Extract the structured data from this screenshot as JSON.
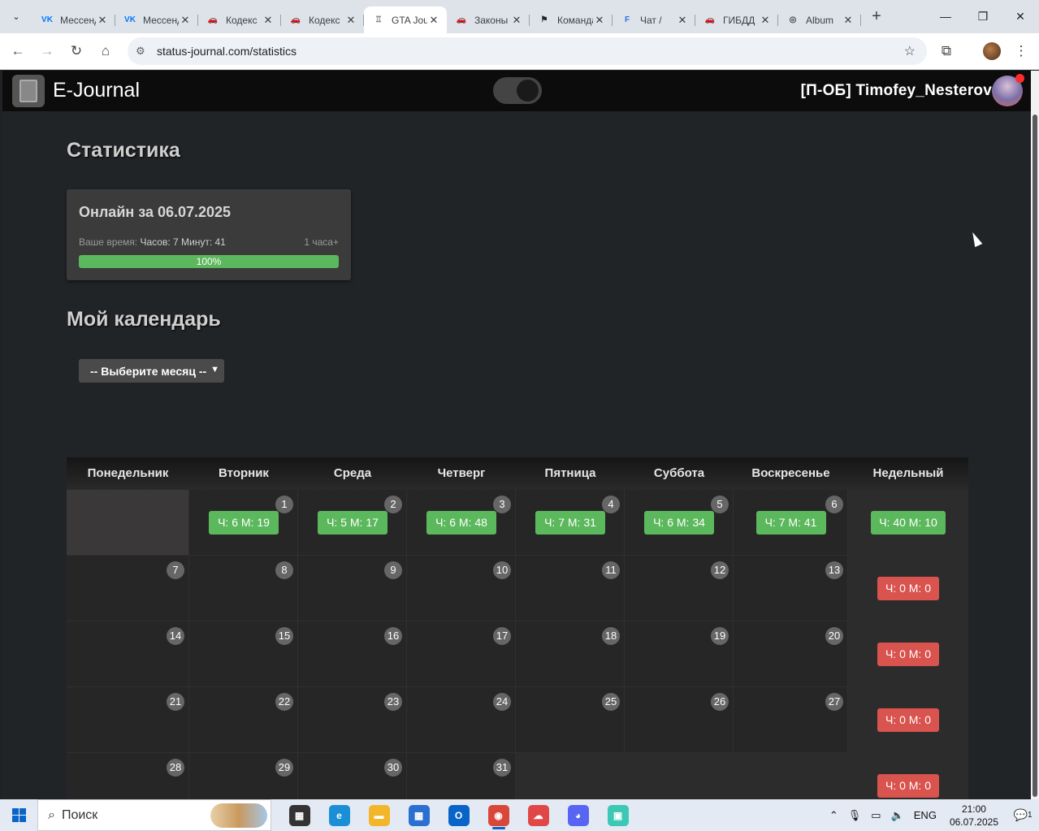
{
  "browser": {
    "tabs": [
      {
        "title": "Мессенджер",
        "icon": "vk-icon",
        "color": "#0077ff",
        "glyph": "VK"
      },
      {
        "title": "Мессенджер",
        "icon": "vk-icon",
        "color": "#0077ff",
        "glyph": "VK"
      },
      {
        "title": "Кодекс",
        "icon": "car-icon",
        "color": "#555555",
        "glyph": "🚗"
      },
      {
        "title": "Кодекс",
        "icon": "car-icon",
        "color": "#555555",
        "glyph": "🚗"
      },
      {
        "title": "GTA Journal",
        "icon": "bell-icon",
        "color": "#888888",
        "glyph": "♖",
        "active": true
      },
      {
        "title": "Законы",
        "icon": "car-icon",
        "color": "#555555",
        "glyph": "🚗"
      },
      {
        "title": "Команда",
        "icon": "flag-icon",
        "color": "#222222",
        "glyph": "⚑"
      },
      {
        "title": "Чат / ",
        "icon": "forum-icon",
        "color": "#2f6fe0",
        "glyph": "F"
      },
      {
        "title": "ГИБДД",
        "icon": "car-icon",
        "color": "#555555",
        "glyph": "🚗"
      },
      {
        "title": "Album",
        "icon": "album-icon",
        "color": "#444444",
        "glyph": "◎"
      }
    ],
    "url": "status-journal.com/statistics"
  },
  "header": {
    "brand": "E-Journal",
    "user": "[П-ОБ] Timofey_Nesterov"
  },
  "stats": {
    "title": "Статистика",
    "card_title": "Онлайн за 06.07.2025",
    "time_label": "Ваше время:",
    "time_value": "Часов: 7 Минут: 41",
    "goal": "1 часа+",
    "progress_label": "100%",
    "progress": 1.0
  },
  "calendar": {
    "title": "Мой календарь",
    "month_select": "-- Выберите месяц --",
    "headers": [
      "Понедельник",
      "Вторник",
      "Среда",
      "Четверг",
      "Пятница",
      "Суббота",
      "Воскресенье",
      "Недельный"
    ],
    "weeks": [
      {
        "days": [
          null,
          {
            "n": "1",
            "t": "Ч: 6 М: 19"
          },
          {
            "n": "2",
            "t": "Ч: 5 М: 17"
          },
          {
            "n": "3",
            "t": "Ч: 6 М: 48"
          },
          {
            "n": "4",
            "t": "Ч: 7 М: 31"
          },
          {
            "n": "5",
            "t": "Ч: 6 М: 34"
          },
          {
            "n": "6",
            "t": "Ч: 7 М: 41"
          }
        ],
        "total": "Ч: 40 М: 10",
        "status": "green"
      },
      {
        "days": [
          {
            "n": "7"
          },
          {
            "n": "8"
          },
          {
            "n": "9"
          },
          {
            "n": "10"
          },
          {
            "n": "11"
          },
          {
            "n": "12"
          },
          {
            "n": "13"
          }
        ],
        "total": "Ч: 0 М: 0",
        "status": "red"
      },
      {
        "days": [
          {
            "n": "14"
          },
          {
            "n": "15"
          },
          {
            "n": "16"
          },
          {
            "n": "17"
          },
          {
            "n": "18"
          },
          {
            "n": "19"
          },
          {
            "n": "20"
          }
        ],
        "total": "Ч: 0 М: 0",
        "status": "red"
      },
      {
        "days": [
          {
            "n": "21"
          },
          {
            "n": "22"
          },
          {
            "n": "23"
          },
          {
            "n": "24"
          },
          {
            "n": "25"
          },
          {
            "n": "26"
          },
          {
            "n": "27"
          }
        ],
        "total": "Ч: 0 М: 0",
        "status": "red"
      },
      {
        "days": [
          {
            "n": "28"
          },
          {
            "n": "29"
          },
          {
            "n": "30"
          },
          {
            "n": "31"
          }
        ],
        "total": "Ч: 0 М: 0",
        "status": "red"
      }
    ]
  },
  "taskbar": {
    "search_placeholder": "Поиск",
    "lang": "ENG",
    "time": "21:00",
    "date": "06.07.2025",
    "notifications": "1",
    "apps": [
      {
        "name": "task-view-icon",
        "color": "#333333",
        "glyph": "▦"
      },
      {
        "name": "edge-icon",
        "color": "#1a8fd6",
        "glyph": "e"
      },
      {
        "name": "file-explorer-icon",
        "color": "#f3b62b",
        "glyph": "▬"
      },
      {
        "name": "store-icon",
        "color": "#2b6fd1",
        "glyph": "▦"
      },
      {
        "name": "outlook-icon",
        "color": "#0a64c8",
        "glyph": "O"
      },
      {
        "name": "chrome-icon",
        "color": "#d9473a",
        "glyph": "◉",
        "active": true
      },
      {
        "name": "cloud-app-icon",
        "color": "#e04848",
        "glyph": "☁"
      },
      {
        "name": "discord-icon",
        "color": "#5865f2",
        "glyph": "◕"
      },
      {
        "name": "messenger-app-icon",
        "color": "#3cc8b4",
        "glyph": "▣"
      }
    ]
  },
  "colors": {
    "green": "#5cb85c",
    "red": "#d9534f",
    "page_bg": "#212427"
  }
}
